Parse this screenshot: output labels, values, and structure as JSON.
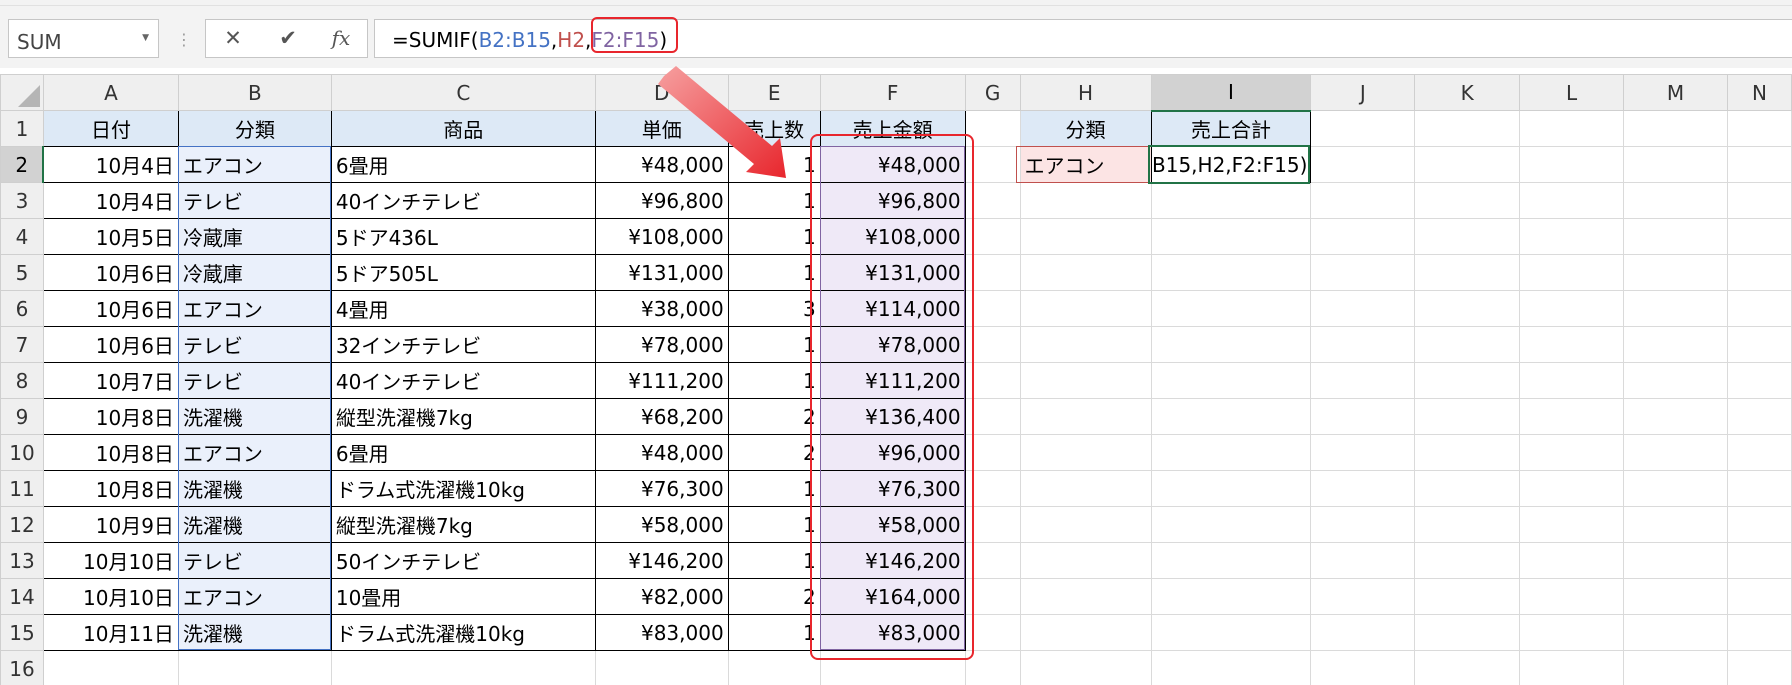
{
  "formula_bar": {
    "name_box": "SUM",
    "cancel_icon": "✕",
    "enter_icon": "✔",
    "fx_label": "fx",
    "formula_prefix": "=SUMIF(",
    "formula_arg1": "B2:B15",
    "comma1": ",",
    "formula_arg2": "H2",
    "comma2": ",",
    "formula_arg3": "F2:F15",
    "formula_suffix": ")"
  },
  "columns": [
    "A",
    "B",
    "C",
    "D",
    "E",
    "F",
    "G",
    "H",
    "I",
    "J",
    "K",
    "L",
    "M",
    "N"
  ],
  "row_numbers": [
    "1",
    "2",
    "3",
    "4",
    "5",
    "6",
    "7",
    "8",
    "9",
    "10",
    "11",
    "12",
    "13",
    "14",
    "15",
    "16"
  ],
  "table": {
    "headers": [
      "日付",
      "分類",
      "商品",
      "単価",
      "売上数",
      "売上金額"
    ],
    "rows": [
      [
        "10月4日",
        "エアコン",
        "6畳用",
        "¥48,000",
        "1",
        "¥48,000"
      ],
      [
        "10月4日",
        "テレビ",
        "40インチテレビ",
        "¥96,800",
        "1",
        "¥96,800"
      ],
      [
        "10月5日",
        "冷蔵庫",
        "5ドア436L",
        "¥108,000",
        "1",
        "¥108,000"
      ],
      [
        "10月6日",
        "冷蔵庫",
        "5ドア505L",
        "¥131,000",
        "1",
        "¥131,000"
      ],
      [
        "10月6日",
        "エアコン",
        "4畳用",
        "¥38,000",
        "3",
        "¥114,000"
      ],
      [
        "10月6日",
        "テレビ",
        "32インチテレビ",
        "¥78,000",
        "1",
        "¥78,000"
      ],
      [
        "10月7日",
        "テレビ",
        "40インチテレビ",
        "¥111,200",
        "1",
        "¥111,200"
      ],
      [
        "10月8日",
        "洗濯機",
        "縦型洗濯機7kg",
        "¥68,200",
        "2",
        "¥136,400"
      ],
      [
        "10月8日",
        "エアコン",
        "6畳用",
        "¥48,000",
        "2",
        "¥96,000"
      ],
      [
        "10月8日",
        "洗濯機",
        "ドラム式洗濯機10kg",
        "¥76,300",
        "1",
        "¥76,300"
      ],
      [
        "10月9日",
        "洗濯機",
        "縦型洗濯機7kg",
        "¥58,000",
        "1",
        "¥58,000"
      ],
      [
        "10月10日",
        "テレビ",
        "50インチテレビ",
        "¥146,200",
        "1",
        "¥146,200"
      ],
      [
        "10月10日",
        "エアコン",
        "10畳用",
        "¥82,000",
        "2",
        "¥164,000"
      ],
      [
        "10月11日",
        "洗濯機",
        "ドラム式洗濯機10kg",
        "¥83,000",
        "1",
        "¥83,000"
      ]
    ]
  },
  "summary": {
    "header_category": "分類",
    "header_total": "売上合計",
    "category_value": "エアコン",
    "editing_text": "B15,H2,F2:F15)"
  },
  "colors": {
    "ref_blue": "#4472c4",
    "ref_red": "#c0504d",
    "ref_purple": "#8064a2",
    "highlight_red": "#e8262d",
    "excel_green": "#217346"
  }
}
